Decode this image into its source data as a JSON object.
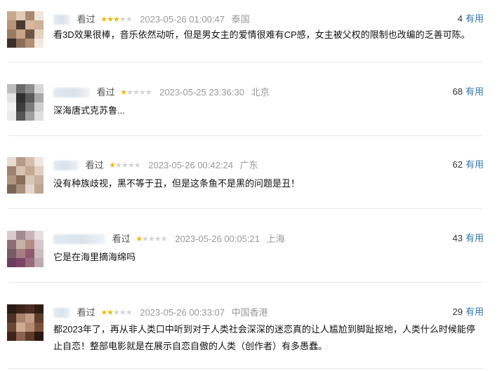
{
  "reviews": [
    {
      "status": "看过",
      "rating": 3,
      "time": "2023-05-26 01:00:47",
      "location": "泰国",
      "votes": "4",
      "content": "看3D效果很棒，音乐依然动听，但是男女主的爱情很难有CP感，女主被父权的限制也改编的乏善可陈。"
    },
    {
      "status": "看过",
      "rating": 1,
      "time": "2023-05-25 23:36:30",
      "location": "北京",
      "votes": "68",
      "content": "深海唐式克苏鲁..."
    },
    {
      "status": "看过",
      "rating": 1,
      "time": "2023-05-26 00:42:24",
      "location": "广东",
      "votes": "62",
      "content": "没有种族歧视，黑不等于丑，但是这条鱼不是黑的问题是丑！"
    },
    {
      "status": "看过",
      "rating": 1,
      "time": "2023-05-26 00:05:21",
      "location": "上海",
      "votes": "43",
      "content": "它是在海里摘海绵吗"
    },
    {
      "status": "看过",
      "rating": 2,
      "time": "2023-05-26 00:33:07",
      "location": "中国香港",
      "votes": "29",
      "content_lines": [
        "都2023年了，再从非人类口中听到对于人类社会深深的迷恋真的让人尴尬到脚趾抠地，人类什么时候能停",
        "止自恋！整部电影就是在展示自恋自傲的人类（创作者）有多愚蠢。"
      ]
    }
  ],
  "labels": {
    "useful": "有用"
  },
  "colors": {
    "star_on": "#f5b800",
    "star_off": "#d3d3d3",
    "link": "#3377aa",
    "meta_gray": "#9a9a9a"
  }
}
